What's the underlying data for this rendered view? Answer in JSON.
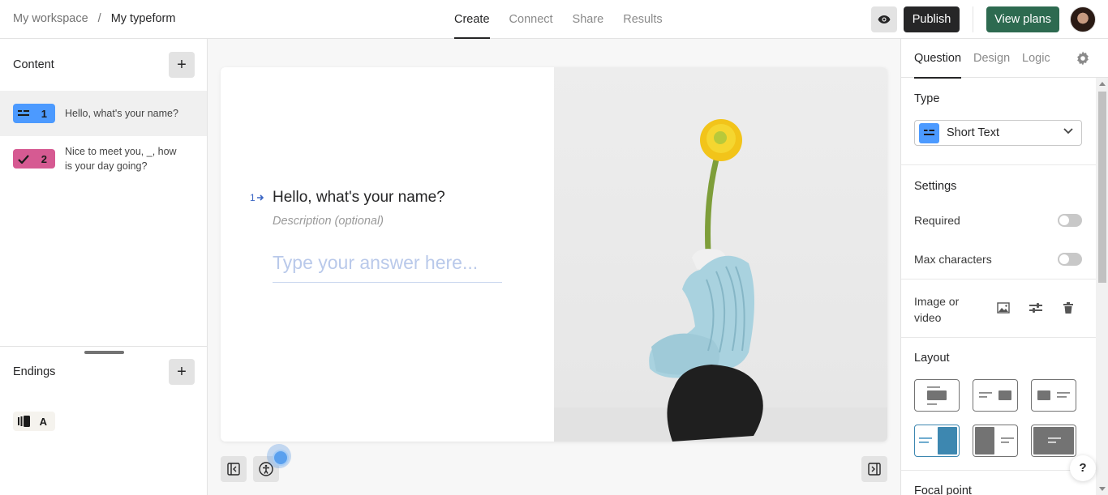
{
  "header": {
    "breadcrumb": [
      "My workspace",
      "My typeform"
    ],
    "breadcrumb_separator": "/",
    "tabs": [
      {
        "label": "Create",
        "active": true
      },
      {
        "label": "Connect",
        "active": false
      },
      {
        "label": "Share",
        "active": false
      },
      {
        "label": "Results",
        "active": false
      }
    ],
    "preview_icon": "eye-icon",
    "publish_label": "Publish",
    "view_plans_label": "View plans"
  },
  "sidebar": {
    "content_title": "Content",
    "add_label": "+",
    "questions": [
      {
        "number": "1",
        "text": "Hello, what's your name?",
        "icon": "short-text-icon",
        "color": "#4c9aff",
        "selected": true
      },
      {
        "number": "2",
        "text": "Nice to meet you, _, how is your day going?",
        "icon": "checkmark-icon",
        "color": "#d65a92",
        "selected": false
      }
    ],
    "endings_title": "Endings",
    "endings": [
      {
        "label": "A",
        "icon": "ending-icon",
        "color": "#f5f3ee"
      }
    ]
  },
  "canvas": {
    "question_number": "1",
    "question_title": "Hello, what's your name?",
    "description_placeholder": "Description (optional)",
    "answer_placeholder": "Type your answer here...",
    "image_alt": "Yellow flower in a light blue knitted sculpture on black rock"
  },
  "panel": {
    "tabs": [
      {
        "label": "Question",
        "active": true
      },
      {
        "label": "Design",
        "active": false
      },
      {
        "label": "Logic",
        "active": false
      }
    ],
    "type_label": "Type",
    "type_value": "Short Text",
    "settings_label": "Settings",
    "required_label": "Required",
    "required_on": false,
    "max_chars_label": "Max characters",
    "max_chars_on": false,
    "image_video_label_1": "Image or",
    "image_video_label_2": "video",
    "layout_label": "Layout",
    "layout_selected": 3,
    "focal_point_label": "Focal point",
    "help_label": "?",
    "accent": "#3d87b0"
  }
}
